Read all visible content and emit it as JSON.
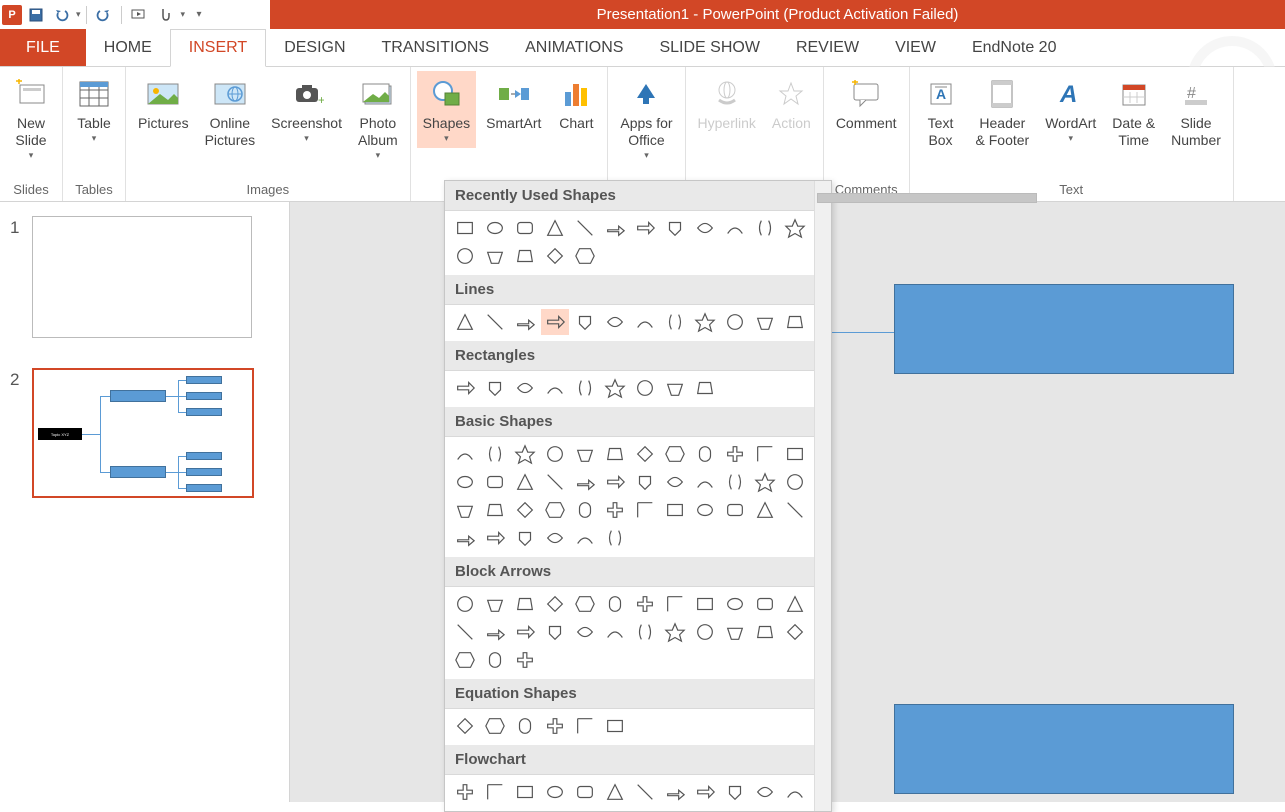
{
  "title": "Presentation1 -  PowerPoint (Product Activation Failed)",
  "tabs": [
    "FILE",
    "HOME",
    "INSERT",
    "DESIGN",
    "TRANSITIONS",
    "ANIMATIONS",
    "SLIDE SHOW",
    "REVIEW",
    "VIEW",
    "EndNote 20"
  ],
  "active_tab": "INSERT",
  "ribbon": {
    "slides": {
      "label": "Slides",
      "new_slide": "New\nSlide"
    },
    "tables": {
      "label": "Tables",
      "table": "Table"
    },
    "images": {
      "label": "Images",
      "pictures": "Pictures",
      "online": "Online\nPictures",
      "screenshot": "Screenshot",
      "album": "Photo\nAlbum"
    },
    "illustrations": {
      "shapes": "Shapes",
      "smartart": "SmartArt",
      "chart": "Chart"
    },
    "apps": {
      "apps": "Apps for\nOffice"
    },
    "links": {
      "hyperlink": "Hyperlink",
      "action": "Action"
    },
    "comments": {
      "label": "Comments",
      "comment": "Comment"
    },
    "text": {
      "label": "Text",
      "textbox": "Text\nBox",
      "header": "Header\n& Footer",
      "wordart": "WordArt",
      "datetime": "Date &\nTime",
      "slidenum": "Slide\nNumber"
    }
  },
  "shapes_panel": {
    "sections": [
      {
        "title": "Recently Used Shapes",
        "count": 17
      },
      {
        "title": "Lines",
        "count": 12
      },
      {
        "title": "Rectangles",
        "count": 9
      },
      {
        "title": "Basic Shapes",
        "count": 42
      },
      {
        "title": "Block Arrows",
        "count": 27
      },
      {
        "title": "Equation Shapes",
        "count": 6
      },
      {
        "title": "Flowchart",
        "count": 12
      }
    ],
    "selected_index": {
      "section": 1,
      "item": 3
    }
  },
  "slides": [
    {
      "num": "1",
      "active": false
    },
    {
      "num": "2",
      "active": true,
      "topic": "Topic XYZ"
    }
  ]
}
